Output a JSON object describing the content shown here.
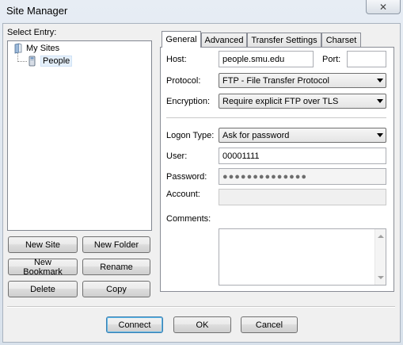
{
  "window": {
    "title": "Site Manager",
    "close_glyph": "✕"
  },
  "left": {
    "select_entry_label": "Select Entry:",
    "tree": {
      "root": {
        "label": "My Sites",
        "icon": "folder-open-icon"
      },
      "child": {
        "label": "People",
        "icon": "server-icon",
        "selected": true
      }
    },
    "buttons": {
      "new_site": "New Site",
      "new_folder": "New Folder",
      "new_bookmark": "New Bookmark",
      "rename": "Rename",
      "delete": "Delete",
      "copy": "Copy"
    }
  },
  "tabs": [
    {
      "label": "General",
      "active": true
    },
    {
      "label": "Advanced",
      "active": false
    },
    {
      "label": "Transfer Settings",
      "active": false
    },
    {
      "label": "Charset",
      "active": false
    }
  ],
  "general": {
    "host_label": "Host:",
    "host_value": "people.smu.edu",
    "port_label": "Port:",
    "port_value": "",
    "protocol_label": "Protocol:",
    "protocol_value": "FTP - File Transfer Protocol",
    "encryption_label": "Encryption:",
    "encryption_value": "Require explicit FTP over TLS",
    "logon_type_label": "Logon Type:",
    "logon_type_value": "Ask for password",
    "user_label": "User:",
    "user_value": "00001111",
    "password_label": "Password:",
    "password_value": "●●●●●●●●●●●●●●",
    "account_label": "Account:",
    "account_value": "",
    "comments_label": "Comments:",
    "comments_value": ""
  },
  "footer": {
    "connect": "Connect",
    "ok": "OK",
    "cancel": "Cancel"
  }
}
